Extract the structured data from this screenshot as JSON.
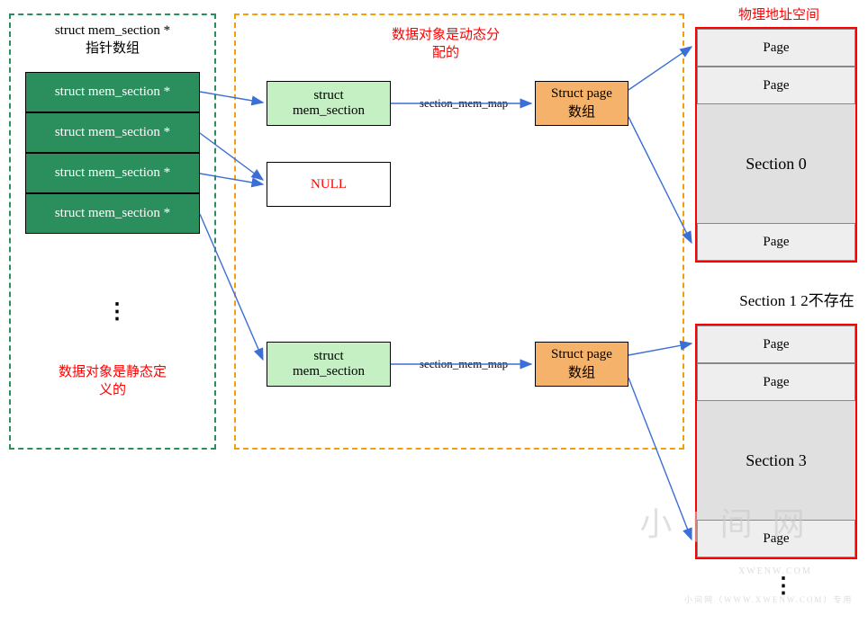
{
  "left": {
    "title_line1": "struct mem_section *",
    "title_line2": "指针数组",
    "rows": [
      "struct mem_section *",
      "struct mem_section *",
      "struct mem_section *",
      "struct mem_section *"
    ],
    "note_line1": "数据对象是静态定",
    "note_line2": "义的"
  },
  "middle": {
    "title_line1": "数据对象是动态分",
    "title_line2": "配的",
    "mem_section_line1": "struct",
    "mem_section_line2": "mem_section",
    "null_label": "NULL",
    "arrow_label": "section_mem_map",
    "struct_page_line1": "Struct page",
    "struct_page_line2": "数组"
  },
  "right": {
    "header": "物理地址空间",
    "page_label": "Page",
    "section0_label": "Section 0",
    "between_label": "Section 1 2不存在",
    "section3_label": "Section 3"
  },
  "watermark": {
    "text": "小 | 间 网",
    "strip": "XWENW.COM",
    "footer": "小间网（WWW.XWENW.COM）专用"
  }
}
